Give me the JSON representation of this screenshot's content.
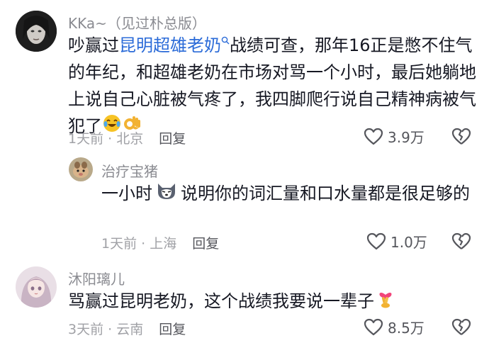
{
  "comments": [
    {
      "username": "KKa~（见过朴总版）",
      "text_before": "吵赢过",
      "link_text": "昆明超雄老奶",
      "text_after": "战绩可查，那年16正是憋不住气的年纪，和超雄老奶在市场对骂一个小时，最后她躺地上说自己心脏被气疼了，我四脚爬行说自己精神病被气犯了",
      "time_location": "1天前 · 北京",
      "reply_label": "回复",
      "likes": "3.9万",
      "icons": [
        "laugh-cry-emoji",
        "ok-hand-emoji"
      ]
    },
    {
      "username": "治疗宝猪",
      "text_before": "一小时",
      "text_after": "说明你的词汇量和口水量都是很足够的",
      "time_location": "1天前 · 上海",
      "reply_label": "回复",
      "likes": "1.0万",
      "icons": [
        "husky-emoji"
      ]
    },
    {
      "username": "沐阳璃儿",
      "text_before": "骂赢过昆明老奶，这个战绩我要说一辈子",
      "time_location": "3天前 · 云南",
      "reply_label": "回复",
      "likes": "8.5万",
      "icons": [
        "crossed-fingers-heart-emoji"
      ]
    }
  ],
  "colors": {
    "link": "#2b6bd8",
    "meta": "#a0a1a6",
    "username": "#8a8b91",
    "text": "#161823"
  }
}
